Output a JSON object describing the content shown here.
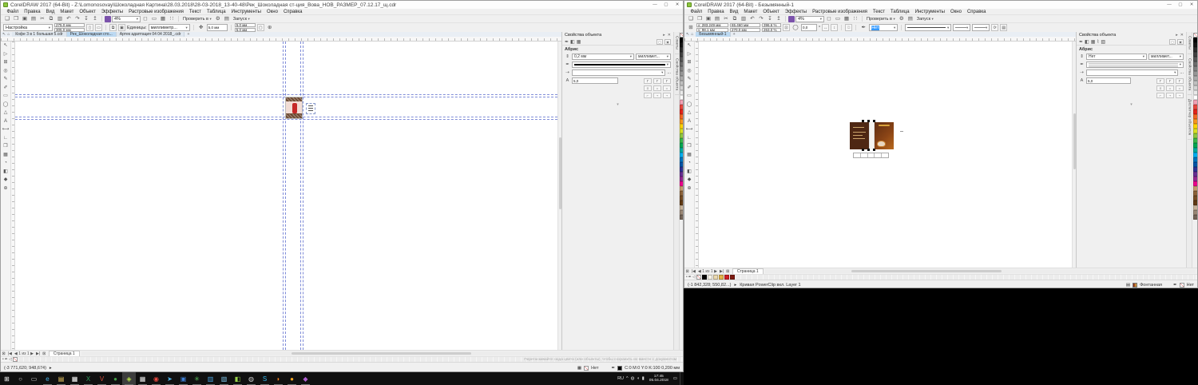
{
  "colors": {
    "accent_blue": "#3399ff",
    "guide_blue": "#5566cc",
    "active_tab": "#bcd9f2",
    "taskbar_bg": "#101010",
    "corel_green": "#8dc63f"
  },
  "menu": [
    "Файл",
    "Правка",
    "Вид",
    "Макет",
    "Объект",
    "Эффекты",
    "Растровые изображения",
    "Текст",
    "Таблица",
    "Инструменты",
    "Окно",
    "Справка"
  ],
  "window_controls": {
    "minimize": "—",
    "maximize": "▢",
    "close": "✕"
  },
  "toolbar_icons": [
    {
      "glyph": "❑",
      "name": "new-document-icon"
    },
    {
      "glyph": "❒",
      "name": "open-icon"
    },
    {
      "glyph": "▣",
      "name": "save-icon"
    },
    {
      "glyph": "▤",
      "name": "print-icon"
    },
    {
      "glyph": "✂",
      "name": "cut-icon"
    },
    {
      "glyph": "⧉",
      "name": "copy-icon"
    },
    {
      "glyph": "▥",
      "name": "paste-icon"
    },
    {
      "glyph": "↶",
      "name": "undo-icon"
    },
    {
      "glyph": "↷",
      "name": "redo-icon"
    },
    {
      "glyph": "↧",
      "name": "import-icon"
    },
    {
      "glyph": "↥",
      "name": "export-icon"
    }
  ],
  "toolbar_view_icons": [
    {
      "glyph": "◻",
      "name": "fullscreen-preview-icon"
    },
    {
      "glyph": "▭",
      "name": "rulers-toggle-icon"
    },
    {
      "glyph": "▦",
      "name": "grid-toggle-icon"
    },
    {
      "glyph": "∷",
      "name": "guidelines-toggle-icon"
    }
  ],
  "toolbar": {
    "check_label": "Проверить в",
    "launch_label": "Запуск",
    "options_icon": "⚙",
    "app_window_icon": "▤"
  },
  "toolbox": [
    {
      "glyph": "↖",
      "name": "pick-tool"
    },
    {
      "glyph": "▷",
      "name": "shape-tool"
    },
    {
      "glyph": "⊞",
      "name": "crop-tool"
    },
    {
      "glyph": "◎",
      "name": "zoom-tool"
    },
    {
      "glyph": "✎",
      "name": "freehand-tool"
    },
    {
      "glyph": "✐",
      "name": "artistic-media-tool"
    },
    {
      "glyph": "▭",
      "name": "rectangle-tool"
    },
    {
      "glyph": "◯",
      "name": "ellipse-tool"
    },
    {
      "glyph": "△",
      "name": "polygon-tool"
    },
    {
      "glyph": "А",
      "name": "text-tool"
    },
    {
      "glyph": "⟷",
      "name": "dimension-tool"
    },
    {
      "glyph": "∟",
      "name": "connector-tool"
    },
    {
      "glyph": "❒",
      "name": "drop-shadow-tool"
    },
    {
      "glyph": "▦",
      "name": "transparency-tool"
    },
    {
      "glyph": "◔",
      "name": "color-eyedropper-tool"
    },
    {
      "glyph": "◧",
      "name": "interactive-fill-tool"
    },
    {
      "glyph": "◆",
      "name": "smart-fill-tool"
    },
    {
      "glyph": "⊕",
      "name": "add-tool-button"
    }
  ],
  "palette_colors": [
    "#000000",
    "#141414",
    "#2b2b2b",
    "#404040",
    "#555555",
    "#6b6b6b",
    "#808080",
    "#959595",
    "#aaaaaa",
    "#bfbfbf",
    "#d4d4d4",
    "#eaeaea",
    "#ffffff",
    "#f2a0b4",
    "#e8453c",
    "#e2231a",
    "#f26522",
    "#f7941d",
    "#ffd200",
    "#d7df23",
    "#8dc63f",
    "#39b54a",
    "#00a651",
    "#00a99d",
    "#00aeef",
    "#0072bc",
    "#0054a6",
    "#2e3192",
    "#662d91",
    "#92278f",
    "#ec008c",
    "#c49a6c",
    "#8c6239",
    "#754c24",
    "#603913",
    "#c7b299",
    "#998675",
    "#736357"
  ],
  "left_window": {
    "title": "CorelDRAW 2017 (64-Bit) - Z:\\Lomonosovay\\Шоколадная Картина\\28.03.2018\\28-03-2018_13-40-48\\Рек_Шоколадная ст-ция_Вова_НОВ_РАЗМЕР_07.12.17_щ.cdr",
    "zoom_value": "4%",
    "property_bar": {
      "preset": "Настройка",
      "page_width": "275,0 мм",
      "page_height": "305,0 мм",
      "units_label": "Единицы:",
      "units_value": "миллиметр...",
      "nudge": "5,0 мм",
      "dup_x": "5,0 мм",
      "dup_y": "5,0 мм"
    },
    "doc_tabs": [
      {
        "label": "Кофе 3 в 1 большая 5.cdr",
        "active": false
      },
      {
        "label": "Рек_Шоколадная сто...",
        "active": true
      },
      {
        "label": "Артек адаптация 04 04 2018_.cdr",
        "active": false
      }
    ],
    "docker": {
      "title": "Свойства объекта",
      "section": "Абрис",
      "width_value": "0,2 мм",
      "units_value": "миллимет...",
      "miter_value": "5,0",
      "more": "..."
    },
    "side_tabs": [
      "Советы",
      "Свойства объекта"
    ],
    "page_nav": {
      "counter": "1 из 1",
      "page_label": "Страница 1"
    },
    "palette_hint": "Перетаскивайте сюда цвета (или объекты), чтобы сохранить их вместе с документом",
    "status": {
      "coords": "(-3 771,620; 948,674)",
      "fill_label": "Нет",
      "outline_label": "C:0 M:0 Y:0 K:100 0,200 мм"
    }
  },
  "right_window": {
    "title": "CorelDRAW 2017 (64-Bit) - Безымянный-1",
    "zoom_value": "4%",
    "property_bar": {
      "x_label": "x:",
      "x_value": "283,249 мм",
      "y_label": "y:",
      "y_value": "98,1 мм",
      "width_value": "65,460 мм",
      "height_value": "270,0 мм",
      "scale_x": "396,6",
      "scale_y": "263,0",
      "percent": "%",
      "angle_value": "0,0",
      "angle_unit": "°",
      "outline_value": "Нет"
    },
    "doc_tabs": [
      {
        "label": "Безымянный-1",
        "active": true
      }
    ],
    "docker": {
      "title": "Свойства объекта",
      "section": "Абрис",
      "width_value": "Нет",
      "units_value": "миллимет...",
      "miter_value": "5,0",
      "more": "..."
    },
    "side_tabs": [
      "Советы",
      "Свойства объекта",
      "Диспетчер объектов"
    ],
    "page_nav": {
      "counter": "1 из 1",
      "page_label": "Страница 1"
    },
    "doc_palette": [
      "#000000",
      "#f7f3e8",
      "#ead9b0",
      "#e3b54a",
      "#cf1f25",
      "#7e1a10"
    ],
    "status": {
      "coords": "(-1 842,328; 550,82...)",
      "object_info": "Кривая PowerClip вкл. Layer 1",
      "fill_label": "Фонтанная",
      "outline_label": "Нет"
    }
  },
  "taskbar": {
    "lang": "RU",
    "time": "17:45",
    "date": "05.04.2018",
    "tray_expand": "^",
    "apps": [
      {
        "glyph": "⊞",
        "color": "#ffffff",
        "name": "start-button"
      },
      {
        "glyph": "○",
        "color": "#cfcfcf",
        "name": "search-icon"
      },
      {
        "glyph": "▭",
        "color": "#cfcfcf",
        "name": "task-view-icon"
      },
      {
        "glyph": "e",
        "color": "#45b0e6",
        "name": "edge-icon",
        "open": true
      },
      {
        "glyph": "▤",
        "color": "#f5cf66",
        "name": "file-explorer-icon",
        "open": true
      },
      {
        "glyph": "▦",
        "color": "#ffffff",
        "name": "store-icon",
        "open": true
      },
      {
        "glyph": "X",
        "color": "#2e9b5b",
        "name": "excel-icon",
        "open": true
      },
      {
        "glyph": "V",
        "color": "#d44a3a",
        "name": "app-icon-red",
        "open": true
      },
      {
        "glyph": "●",
        "color": "#43a047",
        "name": "app-icon-green",
        "open": true
      },
      {
        "glyph": "◈",
        "color": "#b6e04a",
        "name": "coreldraw-icon",
        "open": true,
        "active": true
      },
      {
        "glyph": "▦",
        "color": "#e6e6e6",
        "name": "app-icon-grid",
        "open": true
      },
      {
        "glyph": "◉",
        "color": "#e8483f",
        "name": "chrome-icon",
        "open": true
      },
      {
        "glyph": "➤",
        "color": "#4fb3e8",
        "name": "app-icon-blue",
        "open": true
      },
      {
        "glyph": "▣",
        "color": "#3f7fd4",
        "name": "app-icon-word",
        "open": true
      },
      {
        "glyph": "✳",
        "color": "#58c05a",
        "name": "app-icon-leaf",
        "open": true
      },
      {
        "glyph": "▥",
        "color": "#4aa3df",
        "name": "app-icon-teal",
        "open": true
      },
      {
        "glyph": "▧",
        "color": "#7ec4e8",
        "name": "app-icon-photo",
        "open": true
      },
      {
        "glyph": "◧",
        "color": "#9ad54a",
        "name": "app-icon-lime",
        "open": true
      },
      {
        "glyph": "◍",
        "color": "#cccccc",
        "name": "app-icon-gray",
        "open": true
      },
      {
        "glyph": "S",
        "color": "#35baf0",
        "name": "skype-icon",
        "open": true
      },
      {
        "glyph": "◗",
        "color": "#f58220",
        "name": "firefox-icon",
        "open": true
      },
      {
        "glyph": "●",
        "color": "#f5a623",
        "name": "app-icon-orange",
        "open": true
      },
      {
        "glyph": "◆",
        "color": "#b05fd0",
        "name": "app-icon-purple",
        "open": true
      }
    ]
  }
}
